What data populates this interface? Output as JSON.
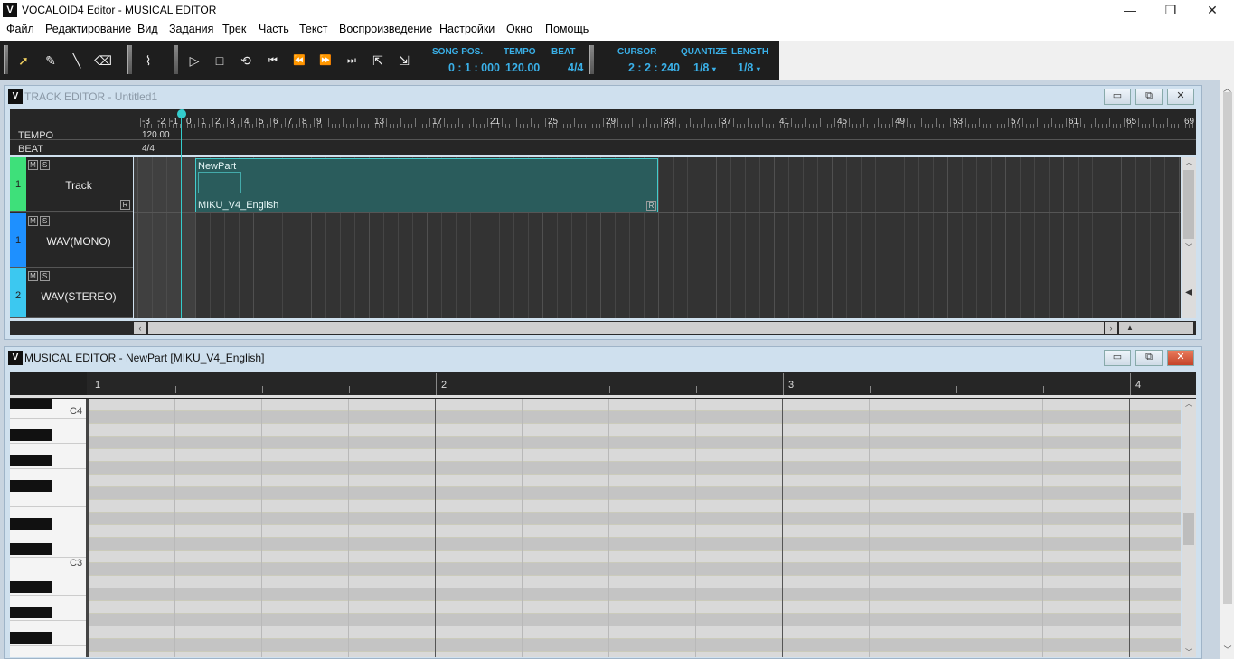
{
  "window": {
    "logo": "V",
    "title": "VOCALOID4 Editor - MUSICAL EDITOR",
    "minimize": "—",
    "maximize": "❐",
    "close": "✕"
  },
  "menu": [
    "Файл",
    "Редактирование",
    "Вид",
    "Задания",
    "Трек",
    "Часть",
    "Текст",
    "Воспроизведение",
    "Настройки",
    "Окно",
    "Помощь"
  ],
  "toolbar": {
    "song_pos_label": "SONG POS.",
    "song_pos_value": "0 : 1 : 000",
    "tempo_label": "TEMPO",
    "tempo_value": "120.00",
    "beat_label": "BEAT",
    "beat_value": "4/4",
    "cursor_label": "CURSOR",
    "cursor_value": "2 : 2 : 240",
    "quantize_label": "QUANTIZE",
    "quantize_value": "1/8",
    "length_label": "LENGTH",
    "length_value": "1/8"
  },
  "track_editor": {
    "title": "TRACK EDITOR - Untitled1",
    "tempo_label": "TEMPO",
    "tempo_value": "120.00",
    "beat_label": "BEAT",
    "beat_value": "4/4",
    "ruler_numbers": [
      "-3",
      "-2",
      "-1",
      "0",
      "1",
      "2",
      "3",
      "4",
      "5",
      "6",
      "7",
      "8",
      "9",
      "13",
      "17",
      "21",
      "25",
      "29",
      "33",
      "37",
      "41",
      "45",
      "49",
      "53",
      "57",
      "61",
      "65",
      "69"
    ],
    "tracks": [
      {
        "num": "1",
        "name": "Track",
        "color": "#3ee07a",
        "m": "M",
        "s": "S"
      },
      {
        "num": "1",
        "name": "WAV(MONO)",
        "color": "#1e90ff",
        "m": "M",
        "s": "S"
      },
      {
        "num": "2",
        "name": "WAV(STEREO)",
        "color": "#3cc8f0",
        "m": "M",
        "s": "S"
      }
    ],
    "part": {
      "name": "NewPart",
      "voice": "MIKU_V4_English",
      "r": "R"
    }
  },
  "musical_editor": {
    "title": "MUSICAL EDITOR - NewPart [MIKU_V4_English]",
    "bars": [
      "1",
      "2",
      "3",
      "4"
    ],
    "octave_labels": [
      "C4",
      "C3"
    ]
  }
}
